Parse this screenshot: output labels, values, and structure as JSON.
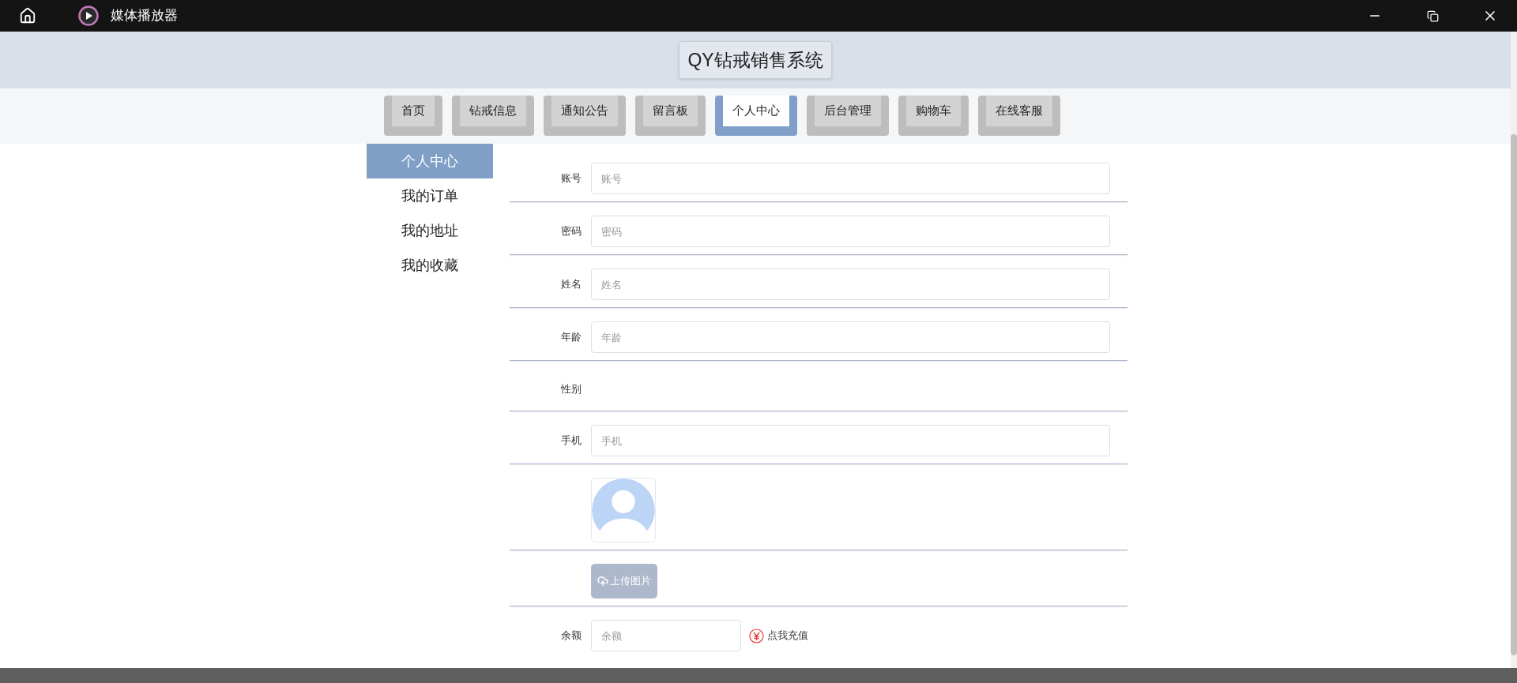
{
  "window": {
    "title": "媒体播放器"
  },
  "header": {
    "title": "QY钻戒销售系统"
  },
  "nav_tabs": [
    {
      "label": "首页",
      "selected": false
    },
    {
      "label": "钻戒信息",
      "selected": false
    },
    {
      "label": "通知公告",
      "selected": false
    },
    {
      "label": "留言板",
      "selected": false
    },
    {
      "label": "个人中心",
      "selected": true
    },
    {
      "label": "后台管理",
      "selected": false
    },
    {
      "label": "购物车",
      "selected": false
    },
    {
      "label": "在线客服",
      "selected": false
    }
  ],
  "sidebar": {
    "items": [
      {
        "label": "个人中心",
        "selected": true
      },
      {
        "label": "我的订单",
        "selected": false
      },
      {
        "label": "我的地址",
        "selected": false
      },
      {
        "label": "我的收藏",
        "selected": false
      }
    ]
  },
  "form": {
    "rows": [
      {
        "kind": "input",
        "label": "账号",
        "placeholder": "账号"
      },
      {
        "kind": "input",
        "label": "密码",
        "placeholder": "密码"
      },
      {
        "kind": "input",
        "label": "姓名",
        "placeholder": "姓名"
      },
      {
        "kind": "input",
        "label": "年龄",
        "placeholder": "年龄"
      },
      {
        "kind": "blank",
        "label": "性别"
      },
      {
        "kind": "input",
        "label": "手机",
        "placeholder": "手机"
      },
      {
        "kind": "avatar"
      },
      {
        "kind": "upload",
        "button": "上传图片"
      },
      {
        "kind": "balance",
        "label": "余额",
        "placeholder": "余额",
        "link": "点我充值"
      }
    ]
  }
}
